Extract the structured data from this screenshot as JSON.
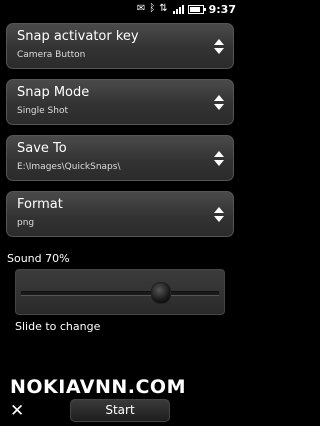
{
  "status_bar": {
    "time": "9:37",
    "icons": [
      "message-icon",
      "bluetooth-icon",
      "network-icon",
      "signal-icon",
      "battery-icon"
    ]
  },
  "settings": [
    {
      "title": "Snap activator key",
      "value": "Camera Button"
    },
    {
      "title": "Snap Mode",
      "value": "Single Shot"
    },
    {
      "title": "Save To",
      "value": "E:\\Images\\QuickSnaps\\"
    },
    {
      "title": "Format",
      "value": "png"
    }
  ],
  "sound": {
    "label": "Sound 70%",
    "level": 0.7,
    "hint": "Slide to change"
  },
  "watermark": "NOKIAVNN.COM",
  "softkeys": {
    "left_icon": "close-icon",
    "center_label": "Start"
  }
}
